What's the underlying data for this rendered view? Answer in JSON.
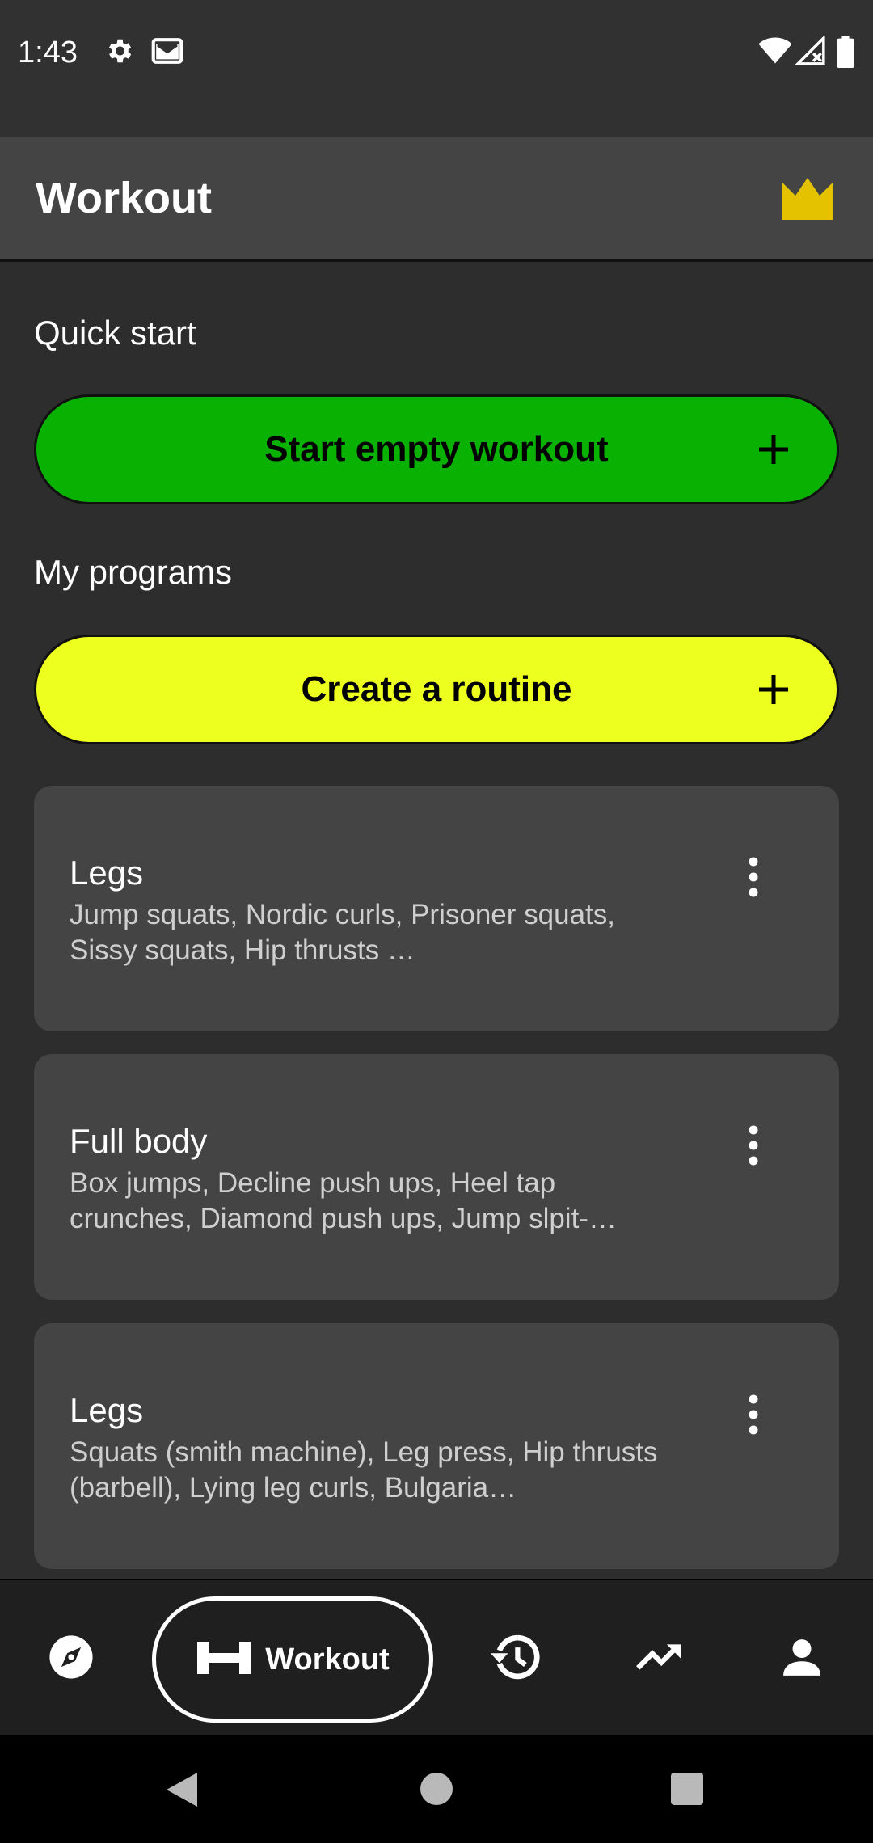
{
  "status_bar": {
    "time": "1:43",
    "icons_left": [
      "gear-icon",
      "mail-icon"
    ],
    "icons_right": [
      "wifi-icon",
      "signal-no-service-icon",
      "battery-icon"
    ]
  },
  "app_bar": {
    "title": "Workout",
    "premium_icon": "crown-icon",
    "premium_color": "#e5c200"
  },
  "quick_start": {
    "section_title": "Quick start",
    "button_label": "Start empty workout",
    "button_color": "#08b102"
  },
  "programs": {
    "section_title": "My programs",
    "create_button_label": "Create a routine",
    "create_button_color": "#ecff1e",
    "routines": [
      {
        "title": "Legs",
        "exercises": "Jump squats, Nordic curls, Prisoner squats, Sissy squats, Hip thrusts …"
      },
      {
        "title": "Full body",
        "exercises": "Box jumps, Decline push ups, Heel tap crunches, Diamond push ups, Jump slpit-…"
      },
      {
        "title": "Legs",
        "exercises": "Squats (smith machine), Leg press, Hip thrusts (barbell), Lying leg curls, Bulgaria…"
      }
    ]
  },
  "bottom_nav": {
    "items": [
      {
        "icon": "compass-icon"
      },
      {
        "icon": "dumbbell-icon",
        "label": "Workout",
        "active": true
      },
      {
        "icon": "history-icon"
      },
      {
        "icon": "trending-up-icon"
      },
      {
        "icon": "person-icon"
      }
    ]
  },
  "system_nav": {
    "icons": [
      "back-icon",
      "home-icon",
      "recents-icon"
    ]
  }
}
